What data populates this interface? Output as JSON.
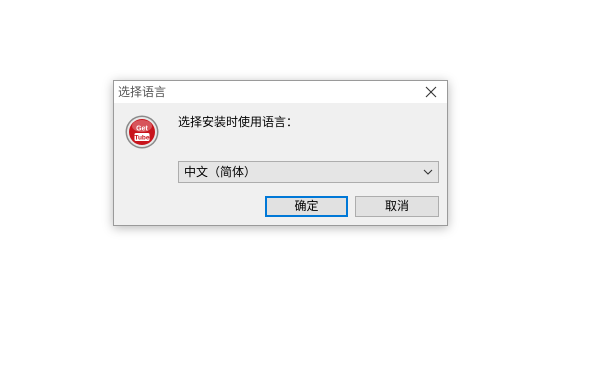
{
  "dialog": {
    "title": "选择语言",
    "prompt": "选择安装时使用语言：",
    "icon_text": [
      "Get",
      "Tube"
    ],
    "language_select": {
      "selected": "中文（简体）"
    },
    "buttons": {
      "ok_label": "确定",
      "cancel_label": "取消"
    }
  },
  "icons": {
    "close": "close-icon",
    "app": "gettube-app-icon",
    "dropdown": "chevron-down-icon"
  },
  "colors": {
    "dialog_bg": "#f0f0f0",
    "titlebar_bg": "#ffffff",
    "default_button_border": "#0078d7",
    "app_icon_red": "#c8141c"
  }
}
